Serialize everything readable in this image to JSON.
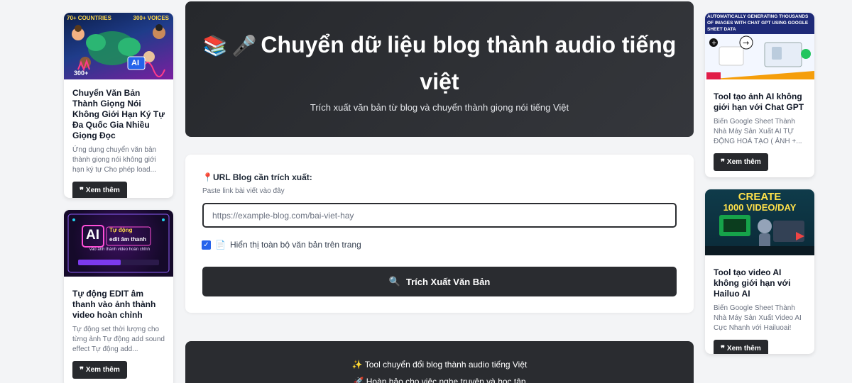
{
  "left_cards": [
    {
      "thumb_badges": {
        "countries": "70+ COUNTRIES",
        "voices": "300+ VOICES",
        "count": "300+",
        "ai": "AI"
      },
      "title": "Chuyển Văn Bản Thành Giọng Nói Không Giới Hạn Ký Tự Đa Quốc Gia Nhiều Giọng Đọc",
      "desc": "Ứng dụng chuyển văn bản thành giọng nói không giới hạn ký tự Cho phép load...",
      "button": "Xem thêm"
    },
    {
      "thumb_text": {
        "ai": "AI",
        "line1": "Tự động",
        "line2": "edit âm thanh",
        "line3": "vào ảnh thành video hoàn chỉnh"
      },
      "title": "Tự động EDIT âm thanh vào ảnh thành video hoàn chỉnh",
      "desc": "Tự động set thời lượng cho từng ảnh Tự động add sound effect Tự động add...",
      "button": "Xem thêm"
    }
  ],
  "right_cards": [
    {
      "thumb_text": "AUTOMATICALLY GENERATING THOUSANDS OF IMAGES WITH CHAT GPT USING GOOGLE SHEET DATA",
      "title": "Tool tạo ảnh AI không giới hạn với Chat GPT",
      "desc": "Biến Google Sheet Thành Nhà Máy Sản Xuất AI TỰ ĐỘNG HOÁ TẠO ( ẢNH +...",
      "button": "Xem thêm"
    },
    {
      "thumb_text": {
        "line1": "CREATE",
        "line2": "1000 VIDEO/DAY"
      },
      "title": "Tool tạo video AI không giới hạn với Hailuo AI",
      "desc": "Biến Google Sheet Thành Nhà Máy Sản Xuất Video AI Cực Nhanh với Hailuoai!",
      "button": "Xem thêm"
    }
  ],
  "hero": {
    "title": "Chuyển dữ liệu blog thành audio tiếng việt",
    "icons": [
      "books-icon",
      "microphone-icon"
    ],
    "subtitle": "Trích xuất văn bản từ blog và chuyển thành giọng nói tiếng Việt"
  },
  "form": {
    "label": "URL Blog cần trích xuất:",
    "hint": "Paste link bài viết vào đây",
    "url_value": "",
    "url_placeholder": "https://example-blog.com/bai-viet-hay",
    "checkbox_checked": true,
    "checkbox_label": "Hiển thị toàn bộ văn bản trên trang",
    "submit": "Trích Xuất Văn Bản"
  },
  "info": {
    "line1": "Tool chuyển đổi blog thành audio tiếng Việt",
    "line2": "Hoàn hảo cho việc nghe truyện và học tập"
  },
  "colors": {
    "dark": "#2a2c30",
    "accent_check": "#2563eb",
    "page_bg": "#f3f4f6"
  }
}
